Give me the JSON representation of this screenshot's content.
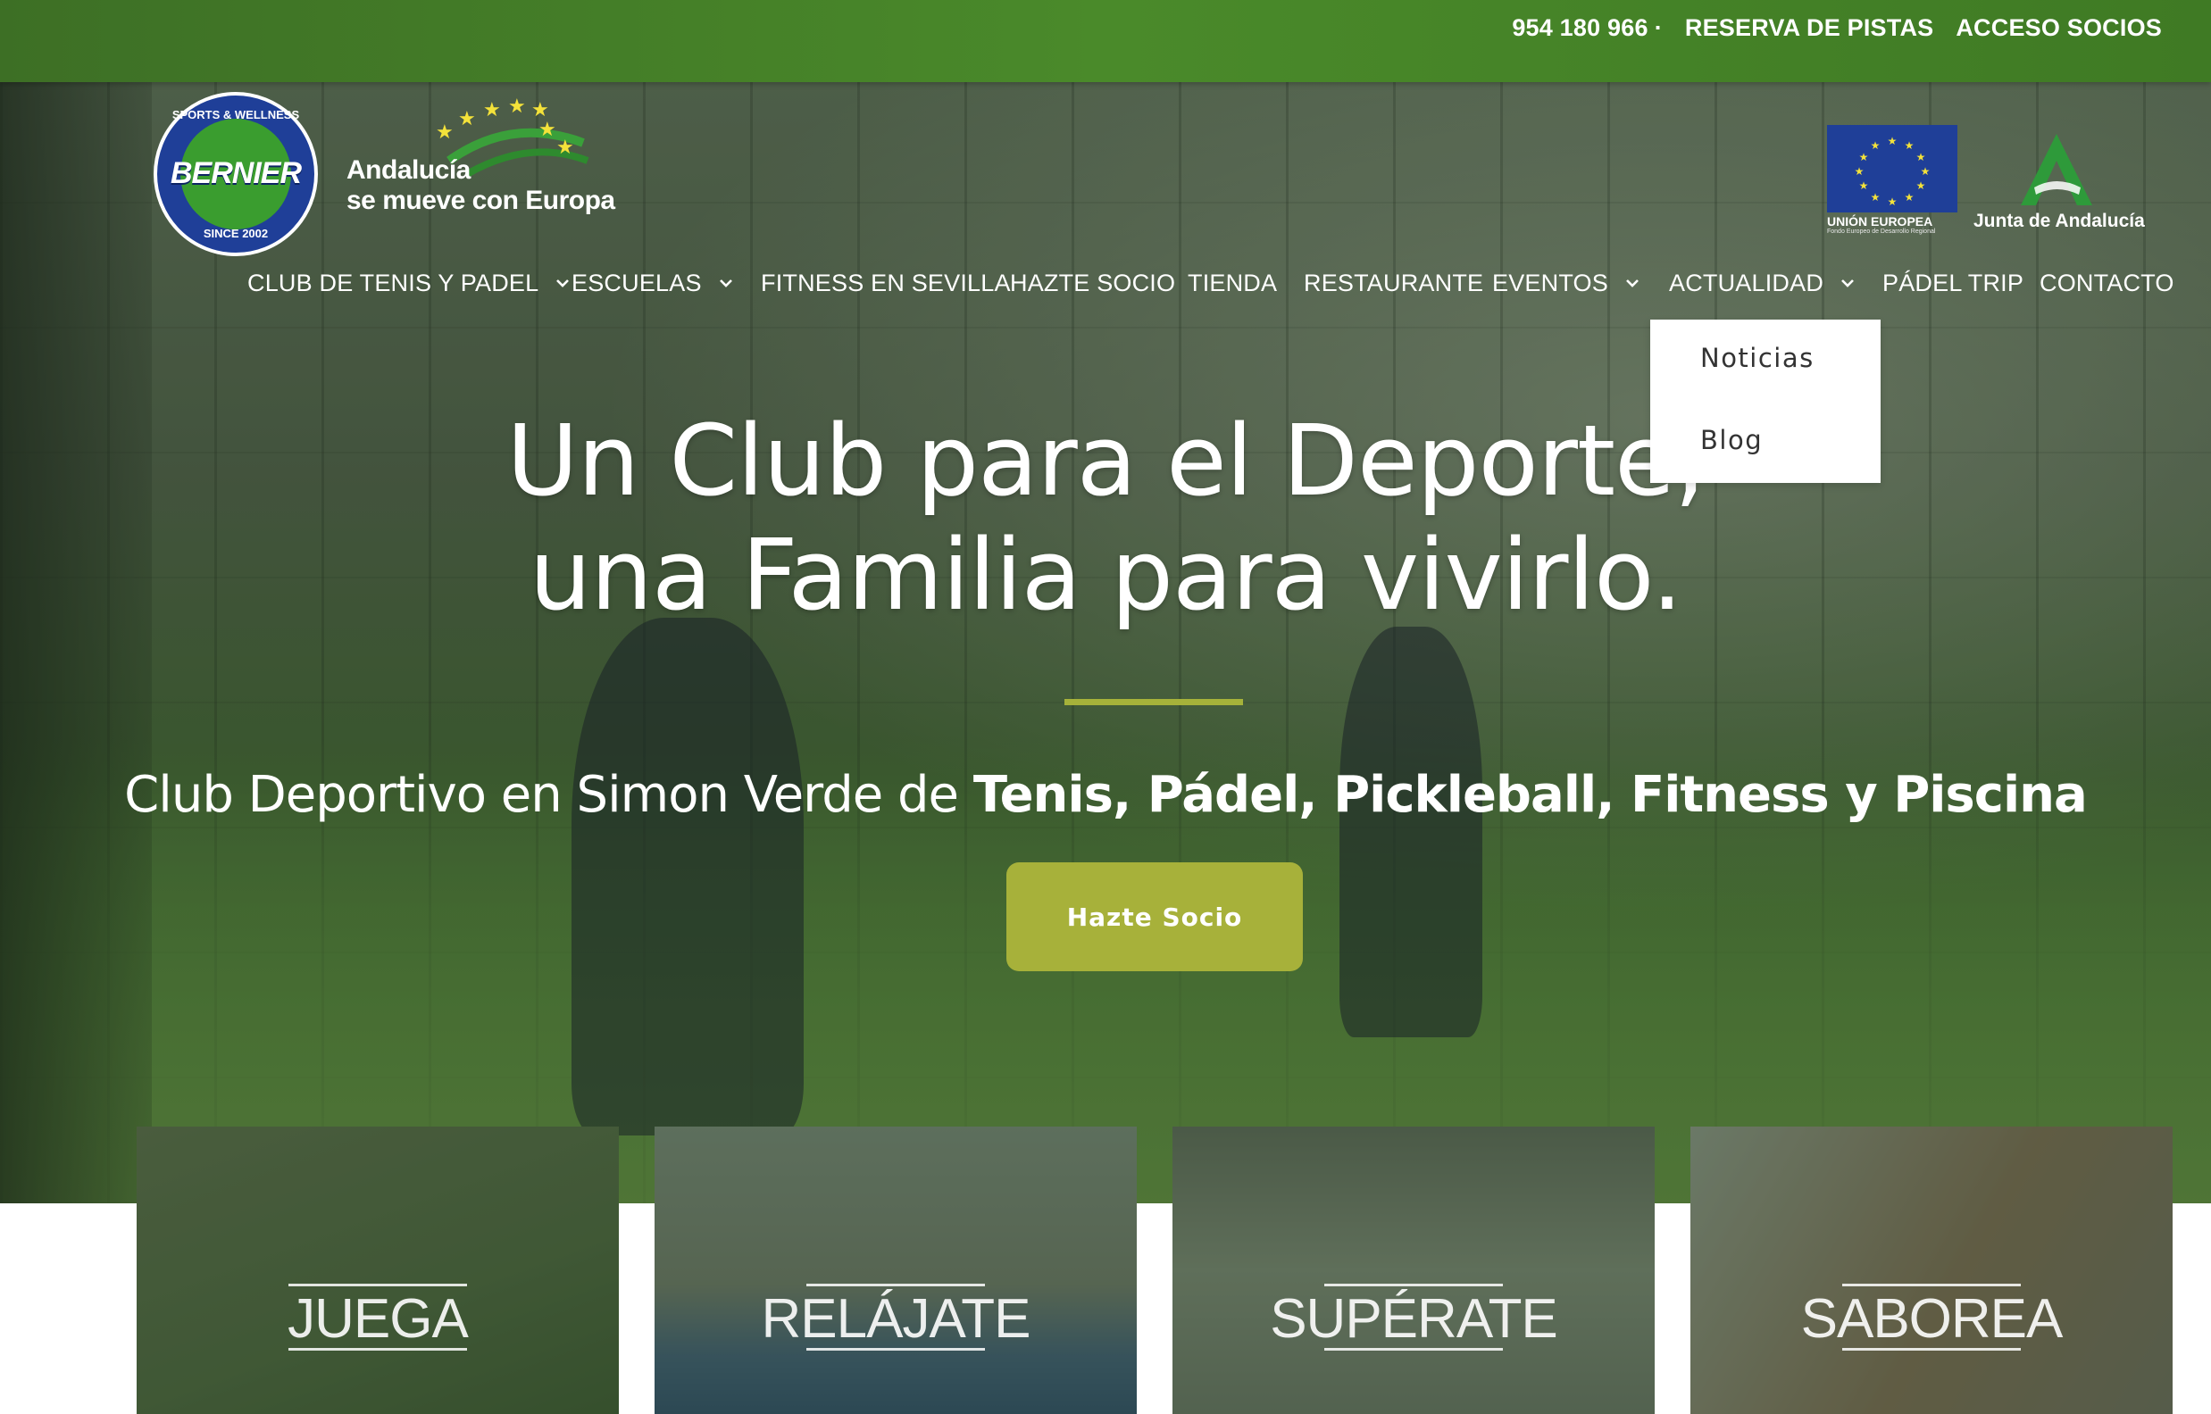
{
  "topbar": {
    "phone": "954 180 966",
    "separator": "·",
    "reserve": "RESERVA DE PISTAS",
    "members": "ACCESO SOCIOS"
  },
  "logos": {
    "bernier": {
      "brand": "BERNIER",
      "ring_top": "SPORTS & WELLNESS",
      "ring_bottom": "SINCE 2002"
    },
    "andalucia": {
      "line1": "Andalucía",
      "line2": "se mueve con Europa"
    },
    "eu": {
      "caption": "UNIÓN EUROPEA",
      "sub": "Fondo Europeo de Desarrollo Regional"
    },
    "junta": {
      "caption": "Junta de Andalucía"
    }
  },
  "nav": {
    "items": [
      {
        "label": "CLUB DE TENIS Y PADEL",
        "has_dropdown": true
      },
      {
        "label": "ESCUELAS",
        "has_dropdown": true
      },
      {
        "label": "FITNESS EN SEVILLA",
        "has_dropdown": false
      },
      {
        "label": "HAZTE SOCIO",
        "has_dropdown": false
      },
      {
        "label": "TIENDA",
        "has_dropdown": false
      },
      {
        "label": "RESTAURANTE",
        "has_dropdown": false
      },
      {
        "label": "EVENTOS",
        "has_dropdown": true
      },
      {
        "label": "ACTUALIDAD",
        "has_dropdown": true
      },
      {
        "label": "PÁDEL TRIP",
        "has_dropdown": false
      },
      {
        "label": "CONTACTO",
        "has_dropdown": false
      }
    ],
    "dropdown": {
      "parent": "ACTUALIDAD",
      "items": [
        "Noticias",
        "Blog"
      ]
    }
  },
  "hero": {
    "title_line1": "Un Club para el Deporte,",
    "title_line2": "una Familia para vivirlo.",
    "subtitle_prefix": "Club Deportivo en Simon Verde de ",
    "subtitle_bold": "Tenis, Pádel, Pickleball, Fitness y Piscina",
    "cta": "Hazte Socio"
  },
  "cards": [
    {
      "label": "JUEGA"
    },
    {
      "label": "RELÁJATE"
    },
    {
      "label": "SUPÉRATE"
    },
    {
      "label": "SABOREA"
    }
  ],
  "colors": {
    "topbar": "#4a8a2a",
    "accent": "#a7b13a",
    "eu_blue": "#1f3f98",
    "junta_green": "#2e9a3a"
  }
}
